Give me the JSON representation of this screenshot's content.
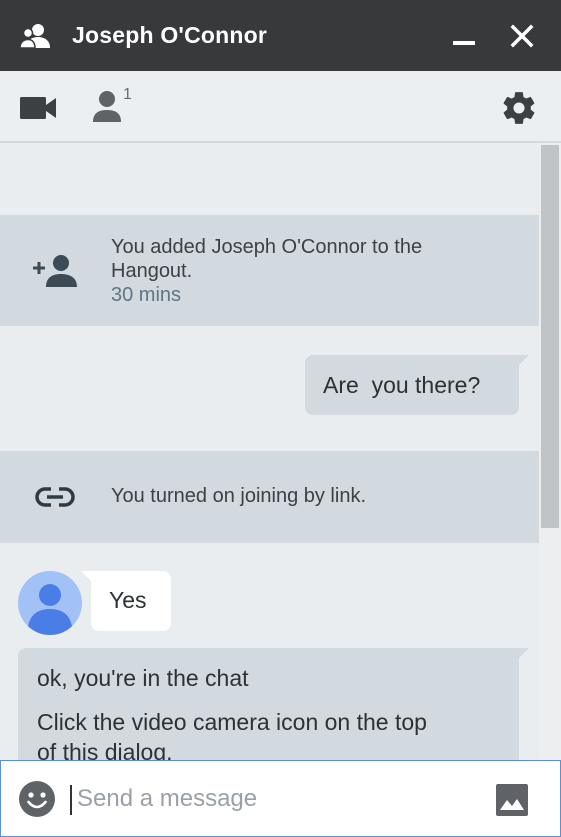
{
  "header": {
    "title": "Joseph O'Connor",
    "icons": {
      "people": "people-icon",
      "minimize": "minimize-icon",
      "close": "close-icon"
    }
  },
  "toolbar": {
    "participant_count": "1",
    "icons": {
      "video": "video-camera-icon",
      "participants": "person-icon",
      "settings": "gear-icon"
    }
  },
  "messages": {
    "system_added": {
      "text": "You added Joseph O'Connor to the Hangout.",
      "time": "30 mins"
    },
    "outgoing_1": "Are  you there?",
    "system_link": {
      "text": "You turned on joining by link."
    },
    "incoming_1": "Yes",
    "outgoing_2": {
      "line1": "ok, you're in the chat",
      "line2": "Click the video camera icon on the top",
      "line3": "of this dialog."
    }
  },
  "composer": {
    "placeholder": "Send a message",
    "value": "",
    "icons": {
      "emoji": "emoji-icon",
      "image": "image-icon"
    }
  },
  "colors": {
    "titlebar": "#38393b",
    "toolbar": "#eceff1",
    "system_row": "#d2d9df",
    "accent_border": "#5b8fdc",
    "avatar_bg": "#a2c1f7",
    "avatar_fg": "#4a7de6"
  }
}
